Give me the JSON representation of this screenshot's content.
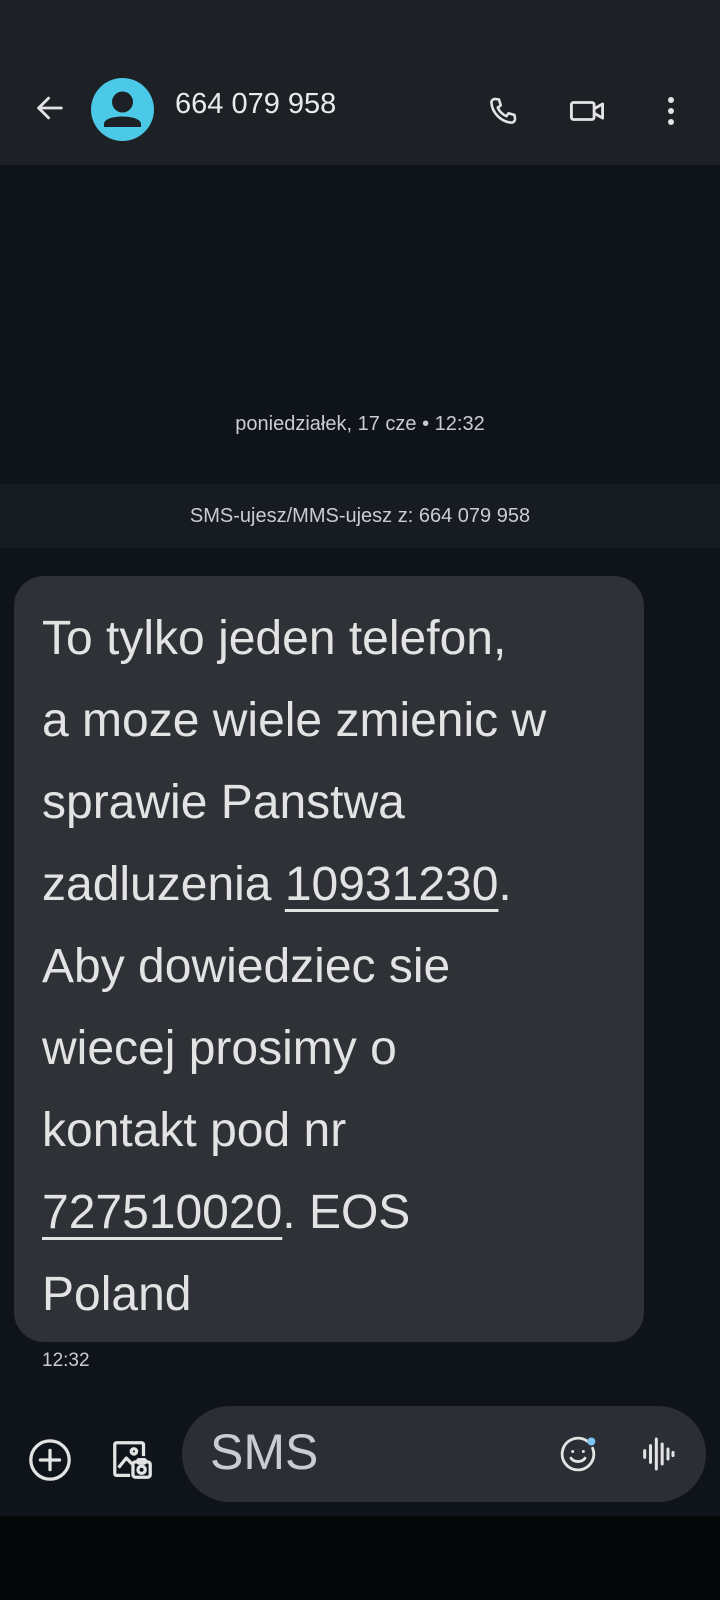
{
  "header": {
    "contact_name": "664 079 958",
    "icons": [
      "back-arrow-icon",
      "contact-avatar-icon",
      "phone-icon",
      "video-call-icon",
      "more-vert-icon"
    ]
  },
  "conversation": {
    "date_label": "poniedziałek, 17 cze • 12:32",
    "sim_banner": "SMS-ujesz/MMS-ujesz z: 664 079 958",
    "message": {
      "lines": [
        {
          "parts": [
            {
              "text": "To tylko jeden telefon,"
            }
          ]
        },
        {
          "parts": [
            {
              "text": "a moze wiele zmienic w"
            }
          ]
        },
        {
          "parts": [
            {
              "text": "sprawie Panstwa"
            }
          ]
        },
        {
          "parts": [
            {
              "text": "zadluzenia "
            },
            {
              "text": "10931230",
              "link": true
            },
            {
              "text": "."
            }
          ]
        },
        {
          "parts": [
            {
              "text": "Aby dowiedziec sie"
            }
          ]
        },
        {
          "parts": [
            {
              "text": "wiecej prosimy o"
            }
          ]
        },
        {
          "parts": [
            {
              "text": "kontakt pod nr"
            }
          ]
        },
        {
          "parts": [
            {
              "text": "727510020",
              "link": true
            },
            {
              "text": ". EOS"
            }
          ]
        },
        {
          "parts": [
            {
              "text": "Poland"
            }
          ]
        }
      ],
      "time": "12:32"
    }
  },
  "composer": {
    "placeholder": "SMS",
    "icons": [
      "add-circle-icon",
      "gallery-icon",
      "emoji-icon",
      "voice-message-icon"
    ],
    "colors": {
      "notification_dot": "#7cc4f4"
    }
  },
  "colors": {
    "background": "#0f141b",
    "header": "#1d2126",
    "bubble": "#2e3135",
    "avatar": "#4cc9e6"
  }
}
